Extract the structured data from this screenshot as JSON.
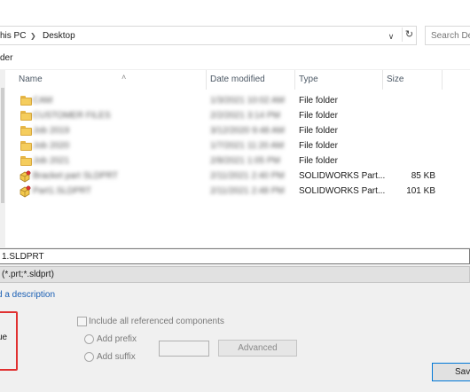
{
  "address": {
    "crumbs": [
      "his PC",
      "Desktop"
    ],
    "search_placeholder": "Search De"
  },
  "toolbar": {
    "new_folder_label": "der"
  },
  "columns": {
    "name": "Name",
    "date_modified": "Date modified",
    "type": "Type",
    "size": "Size"
  },
  "files": [
    {
      "icon": "folder-icon",
      "name": "CAM",
      "date": "1/3/2021 10:02 AM",
      "type": "File folder",
      "size": ""
    },
    {
      "icon": "folder-icon",
      "name": "CUSTOMER FILES",
      "date": "2/2/2021 3:14 PM",
      "type": "File folder",
      "size": ""
    },
    {
      "icon": "folder-icon",
      "name": "Job 2019",
      "date": "3/12/2020 9:48 AM",
      "type": "File folder",
      "size": ""
    },
    {
      "icon": "folder-icon",
      "name": "Job 2020",
      "date": "1/7/2021 11:20 AM",
      "type": "File folder",
      "size": ""
    },
    {
      "icon": "folder-icon",
      "name": "Job 2021",
      "date": "2/8/2021 1:05 PM",
      "type": "File folder",
      "size": ""
    },
    {
      "icon": "solidworks-part-icon",
      "name": "Bracket part SLDPRT",
      "date": "2/11/2021 2:40 PM",
      "type": "SOLIDWORKS Part...",
      "size": "85 KB"
    },
    {
      "icon": "solidworks-part-icon",
      "name": "Part1.SLDPRT",
      "date": "2/11/2021 2:48 PM",
      "type": "SOLIDWORKS Part...",
      "size": "101 KB"
    }
  ],
  "file_name_value": "1.SLDPRT",
  "save_as_type": "(*.prt;*.sldprt)",
  "description_link": "d a description",
  "option_label": "ue",
  "include_refs_label": "Include all referenced components",
  "add_prefix_label": "Add prefix",
  "add_suffix_label": "Add suffix",
  "advanced_label": "Advanced",
  "save_label": "Save"
}
